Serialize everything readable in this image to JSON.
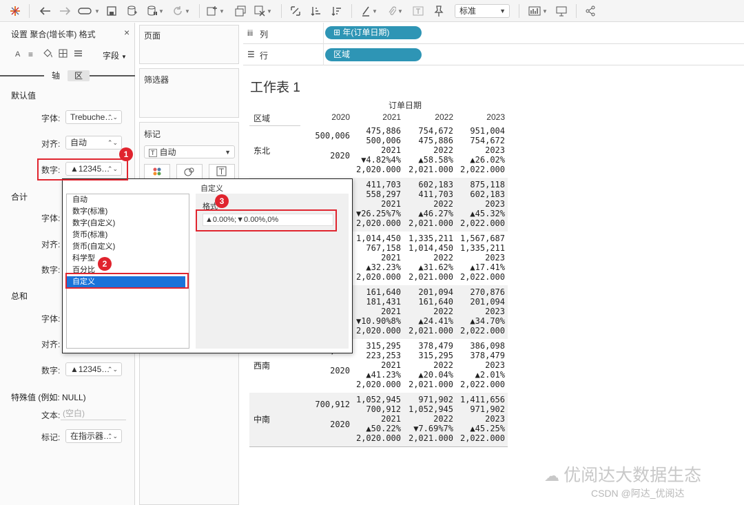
{
  "toolbar": {
    "zoom_value": "标准"
  },
  "format_pane": {
    "title": "设置 聚合(增长率) 格式",
    "scope_label": "字段",
    "tabs": [
      "轴",
      "区"
    ],
    "sections": {
      "default": {
        "title": "默认值",
        "font_label": "字体:",
        "font_value": "Trebuche…",
        "align_label": "对齐:",
        "align_value": "自动",
        "number_label": "数字:",
        "number_value": "▲12345…"
      },
      "total": {
        "title": "合计",
        "font_label": "字体:",
        "align_label": "对齐:",
        "number_label": "数字:"
      },
      "grand": {
        "title": "总和",
        "font_label": "字体:",
        "font_value": "",
        "align_label": "对齐:",
        "align_value": "",
        "number_label": "数字:",
        "number_value": "▲12345…"
      },
      "special": {
        "title": "特殊值 (例如: NULL)",
        "text_label": "文本:",
        "text_placeholder": "(空白)",
        "mark_label": "标记:",
        "mark_value": "在指示器…"
      }
    }
  },
  "shelves": {
    "pages": "页面",
    "filters": "筛选器",
    "marks": "标记",
    "marks_type": "自动",
    "columns_label": "列",
    "rows_label": "行",
    "column_pill": "年(订单日期)",
    "row_pill": "区域"
  },
  "popup": {
    "list": [
      "自动",
      "数字(标准)",
      "数字(自定义)",
      "货币(标准)",
      "货币(自定义)",
      "科学型",
      "百分比",
      "自定义"
    ],
    "selected_index": 7,
    "custom_title": "自定义",
    "format_label": "格式",
    "format_value": "▲0.00%;▼0.00%,0%"
  },
  "badges": [
    "1",
    "2",
    "3"
  ],
  "worksheet": {
    "title": "工作表 1",
    "col_header": "订单日期",
    "row_header": "区域",
    "years": [
      "2020",
      "2021",
      "2022",
      "2023"
    ],
    "rows": [
      {
        "region": "东北",
        "c2020": [
          "500,006",
          "",
          "2020",
          ""
        ],
        "cols": [
          [
            "475,886",
            "500,006",
            "2021",
            "▼4.82%4%",
            "2,020.000"
          ],
          [
            "754,672",
            "475,886",
            "2022",
            "▲58.58%",
            "2,021.000"
          ],
          [
            "951,004",
            "754,672",
            "2023",
            "▲26.02%",
            "2,022.000"
          ]
        ]
      },
      {
        "region": "",
        "c2020": [
          "",
          "",
          "",
          ""
        ],
        "cols": [
          [
            "411,703",
            "558,297",
            "2021",
            "▼26.25%7%",
            "2,020.000"
          ],
          [
            "602,183",
            "411,703",
            "2022",
            "▲46.27%",
            "2,021.000"
          ],
          [
            "875,118",
            "602,183",
            "2023",
            "▲45.32%",
            "2,022.000"
          ]
        ]
      },
      {
        "region": "",
        "c2020": [
          "",
          "",
          "",
          ""
        ],
        "cols": [
          [
            "1,014,450",
            "767,158",
            "2021",
            "▲32.23%",
            "2,020.000"
          ],
          [
            "1,335,211",
            "1,014,450",
            "2022",
            "▲31.62%",
            "2,021.000"
          ],
          [
            "1,567,687",
            "1,335,211",
            "2023",
            "▲17.41%",
            "2,022.000"
          ]
        ]
      },
      {
        "region": "",
        "c2020": [
          "",
          "",
          "",
          ""
        ],
        "cols": [
          [
            "161,640",
            "181,431",
            "2021",
            "▼10.90%8%",
            "2,020.000"
          ],
          [
            "201,094",
            "161,640",
            "2022",
            "▲24.41%",
            "2,021.000"
          ],
          [
            "270,876",
            "201,094",
            "2023",
            "▲34.70%",
            "2,022.000"
          ]
        ]
      },
      {
        "region": "西南",
        "c2020": [
          "223,253",
          "",
          "2020",
          ""
        ],
        "cols": [
          [
            "315,295",
            "223,253",
            "2021",
            "▲41.23%",
            "2,020.000"
          ],
          [
            "378,479",
            "315,295",
            "2022",
            "▲20.04%",
            "2,021.000"
          ],
          [
            "386,098",
            "378,479",
            "2023",
            "▲2.01%",
            "2,022.000"
          ]
        ]
      },
      {
        "region": "中南",
        "c2020": [
          "700,912",
          "",
          "2020",
          ""
        ],
        "cols": [
          [
            "1,052,945",
            "700,912",
            "2021",
            "▲50.22%",
            "2,020.000"
          ],
          [
            "971,902",
            "1,052,945",
            "2022",
            "▼7.69%7%",
            "2,021.000"
          ],
          [
            "1,411,656",
            "971,902",
            "2023",
            "▲45.25%",
            "2,022.000"
          ]
        ]
      }
    ]
  },
  "watermark": {
    "main": "优阅达大数据生态",
    "sub": "CSDN @阿达_优阅达"
  }
}
